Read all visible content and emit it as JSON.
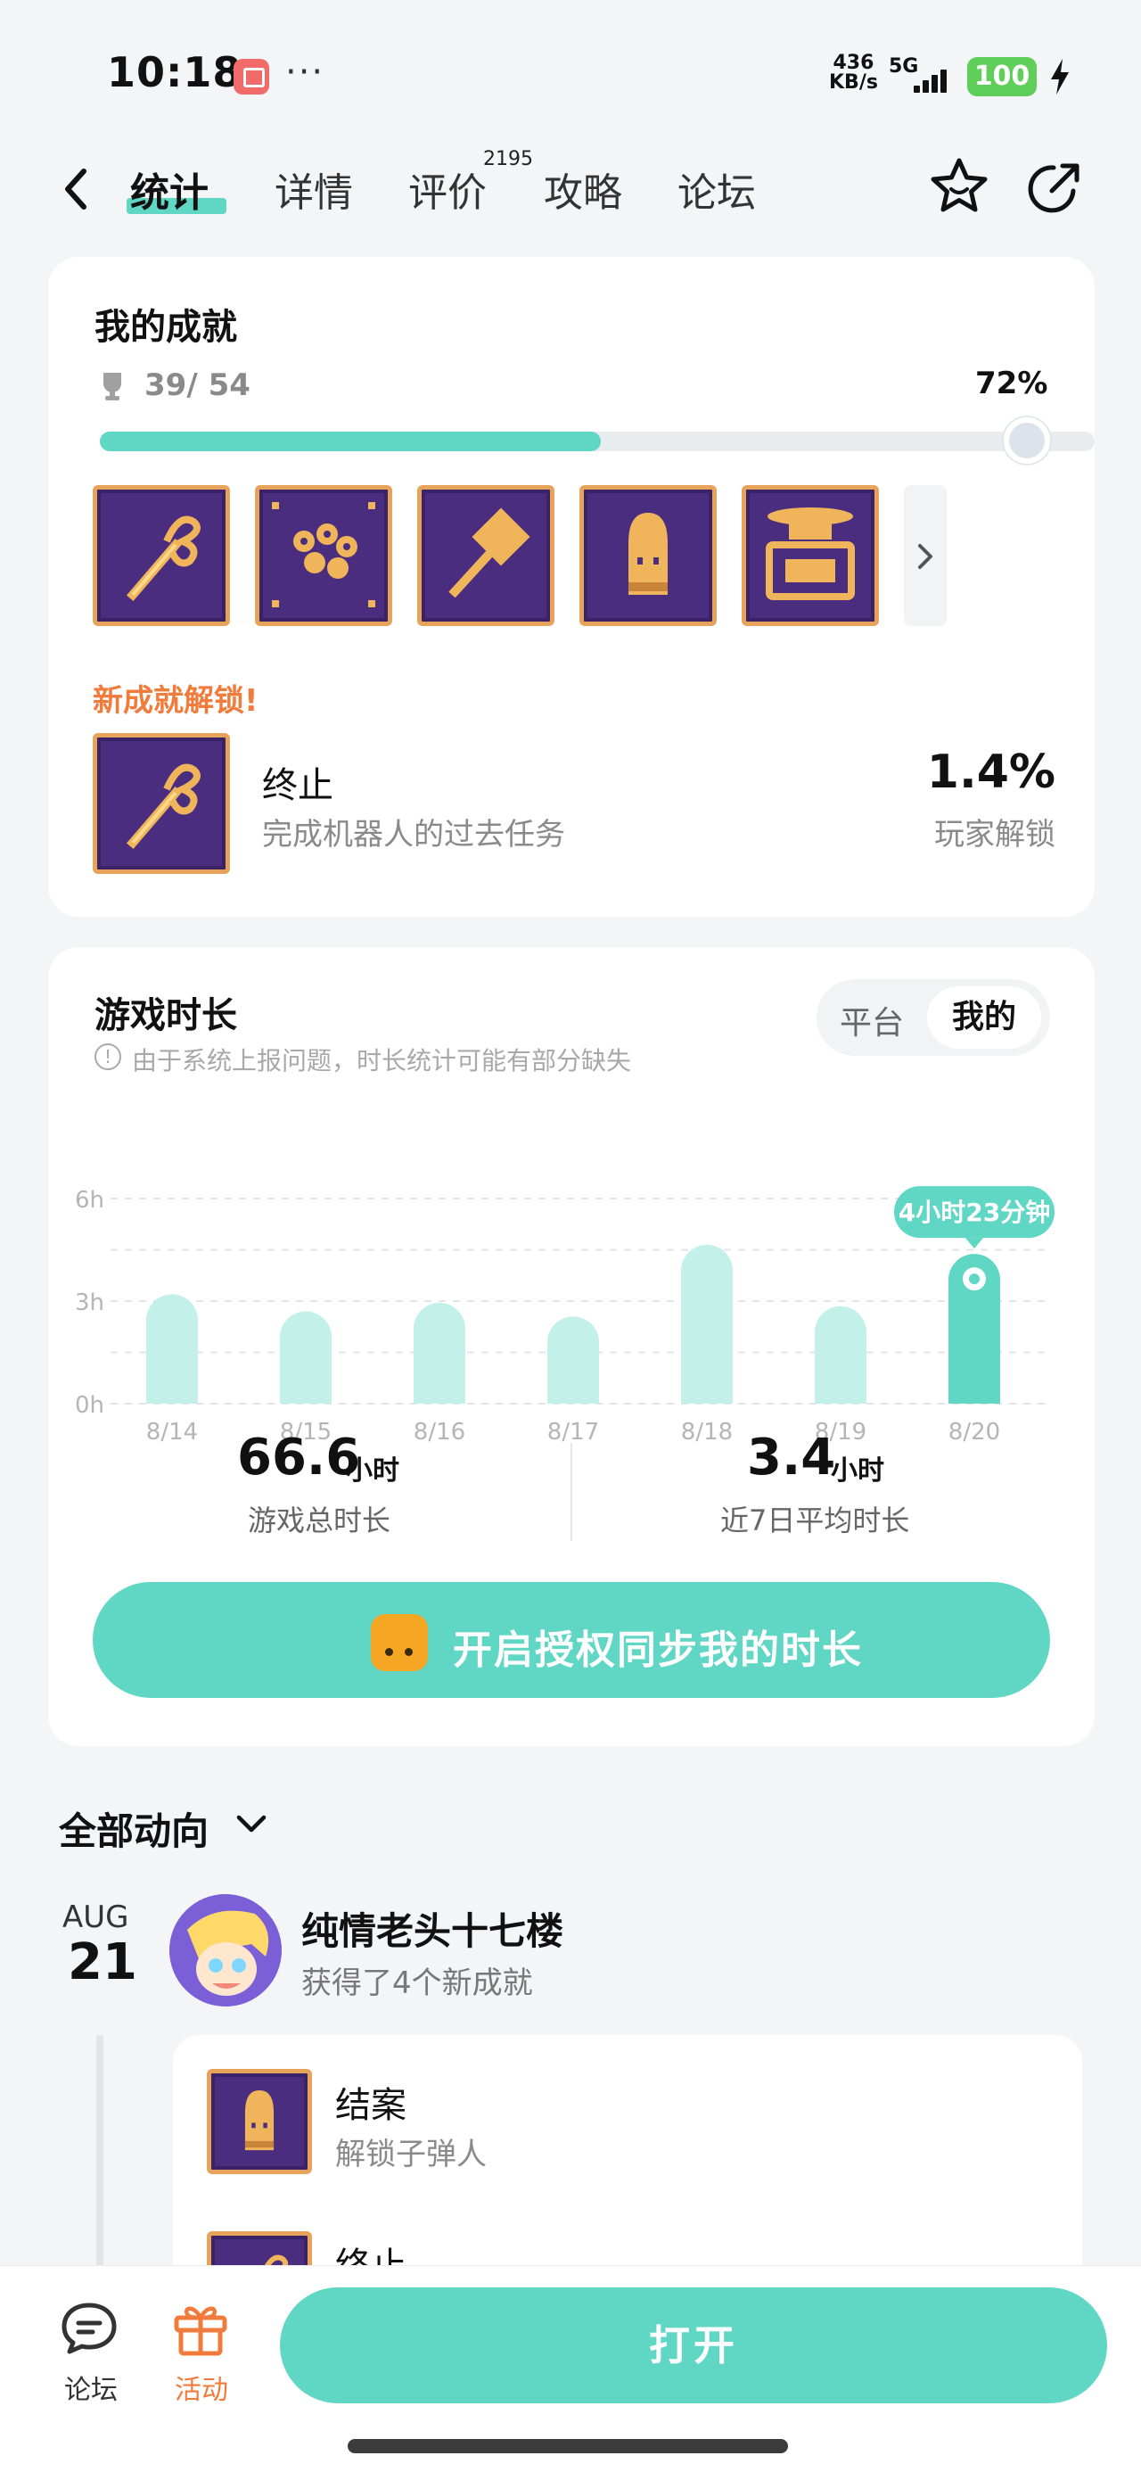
{
  "status_bar": {
    "time": "10:18",
    "more": "···",
    "net_speed": "436",
    "net_unit": "KB/s",
    "network": "5G",
    "battery": "100"
  },
  "nav": {
    "tabs": [
      {
        "label": "统计",
        "active": true
      },
      {
        "label": "详情",
        "active": false
      },
      {
        "label": "评价",
        "active": false,
        "count": "2195"
      },
      {
        "label": "攻略",
        "active": false
      },
      {
        "label": "论坛",
        "active": false
      }
    ],
    "accent_color": "#60d6c4"
  },
  "achievements": {
    "title": "我的成就",
    "count": "39/ 54",
    "unlocked": 39,
    "total": 54,
    "percent_label": "72%",
    "progress_percent": 72,
    "badges": [
      "wand-badge",
      "flowers-badge",
      "hammer-badge",
      "bullet-badge",
      "robot-badge"
    ],
    "new_unlock_label": "新成就解锁!",
    "new_unlock": {
      "name": "终止",
      "description": "完成机器人的过去任务",
      "rate": "1.4%",
      "rate_label": "玩家解锁"
    }
  },
  "playtime": {
    "title": "游戏时长",
    "toggle": {
      "platform": "平台",
      "mine": "我的",
      "selected": "我的"
    },
    "notice": "由于系统上报问题，时长统计可能有部分缺失",
    "total_value": "66.6",
    "total_unit": "小时",
    "total_label": "游戏总时长",
    "avg_value": "3.4",
    "avg_unit": "小时",
    "avg_label": "近7日平均时长",
    "sync_button": "开启授权同步我的时长"
  },
  "chart_data": {
    "type": "bar",
    "categories": [
      "8/14",
      "8/15",
      "8/16",
      "8/17",
      "8/18",
      "8/19",
      "8/20"
    ],
    "values": [
      3.2,
      2.7,
      2.95,
      2.55,
      4.65,
      2.85,
      4.38
    ],
    "yticks": [
      "6h",
      "3h",
      "0h"
    ],
    "ylim": [
      0,
      6
    ],
    "grid": true,
    "highlight_index": 6,
    "highlight_label": "4小时23分钟",
    "bar_color": "#c4f0ea",
    "highlight_color": "#60d6c4"
  },
  "feed": {
    "filter": "全部动向",
    "month": "AUG",
    "day": "21",
    "user_name": "纯情老头十七楼",
    "action": "获得了4个新成就",
    "items": [
      {
        "name": "结案",
        "description": "解锁子弹人"
      },
      {
        "name": "终止",
        "description": ""
      }
    ]
  },
  "bottom_bar": {
    "forum_label": "论坛",
    "activity_label": "活动",
    "open_button": "打开"
  }
}
